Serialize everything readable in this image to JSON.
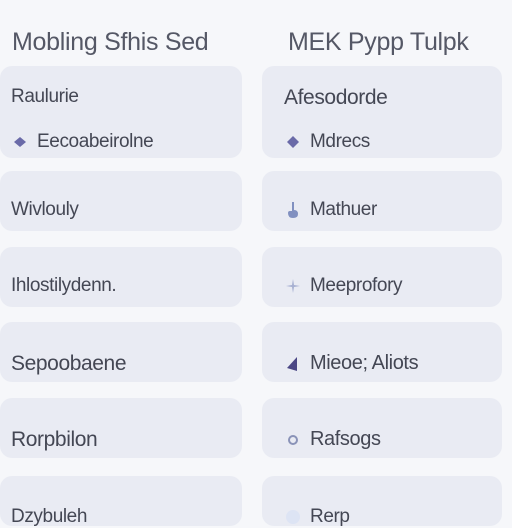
{
  "left": {
    "title": "Mobling Sfhis Sed",
    "items": [
      {
        "label": "Raulurie",
        "icon": ""
      },
      {
        "label": "Eecoabeirolne",
        "icon": "diamond-icon"
      },
      {
        "label": "Wivlouly",
        "icon": ""
      },
      {
        "label": "Ihlostilydenn.",
        "icon": ""
      },
      {
        "label": "Sepoobaene",
        "icon": ""
      },
      {
        "label": "Rorpbilon",
        "icon": ""
      },
      {
        "label": "Dzybuleh",
        "icon": ""
      }
    ]
  },
  "right": {
    "title": "MEK Pypp Tulpk",
    "items": [
      {
        "label": "Afesodorde",
        "icon": ""
      },
      {
        "label": "Mdrecs",
        "icon": "diamond-icon"
      },
      {
        "label": "Mathuer",
        "icon": "hand-icon"
      },
      {
        "label": "Meeprofory",
        "icon": "sparkle-icon"
      },
      {
        "label": "Mieoe; Aliots",
        "icon": "triangle-icon"
      },
      {
        "label": "Rafsogs",
        "icon": "circle-icon"
      },
      {
        "label": "Rerp",
        "icon": "dot-icon"
      }
    ]
  },
  "colors": {
    "background": "#f6f7fa",
    "card": "#e9ebf3",
    "icon": "#6a6aa8",
    "icon_light": "#9ea6c8"
  }
}
